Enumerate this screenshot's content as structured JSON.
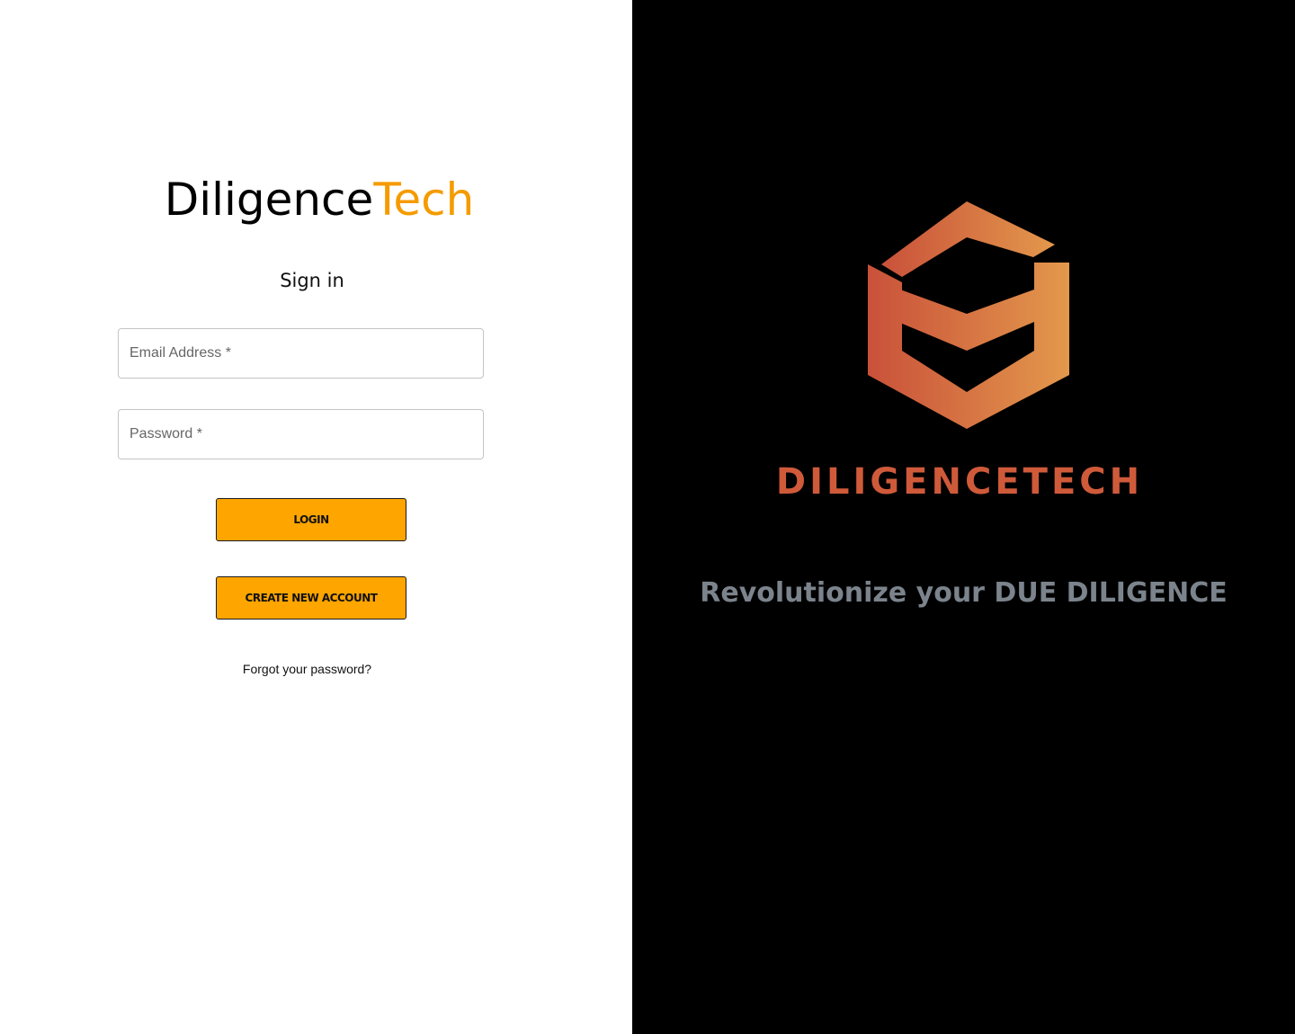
{
  "brand": {
    "name_part1": "Diligence",
    "name_part2": "Tech",
    "accent_color": "#f59b00"
  },
  "form": {
    "heading": "Sign in",
    "email_placeholder": "Email Address *",
    "password_placeholder": "Password *",
    "login_label": "LOGIN",
    "create_account_label": "CREATE NEW ACCOUNT",
    "forgot_label": "Forgot your password?",
    "button_color": "#ffa500"
  },
  "hero": {
    "logo_icon": "diligencetech-hexagon-logo-icon",
    "logo_word": "DILIGENCETECH",
    "logo_gradient": [
      "#c9513a",
      "#e0904a"
    ],
    "tagline": "Revolutionize your DUE DILIGENCE",
    "tagline_color": "#7b838c",
    "background": "#000000"
  }
}
